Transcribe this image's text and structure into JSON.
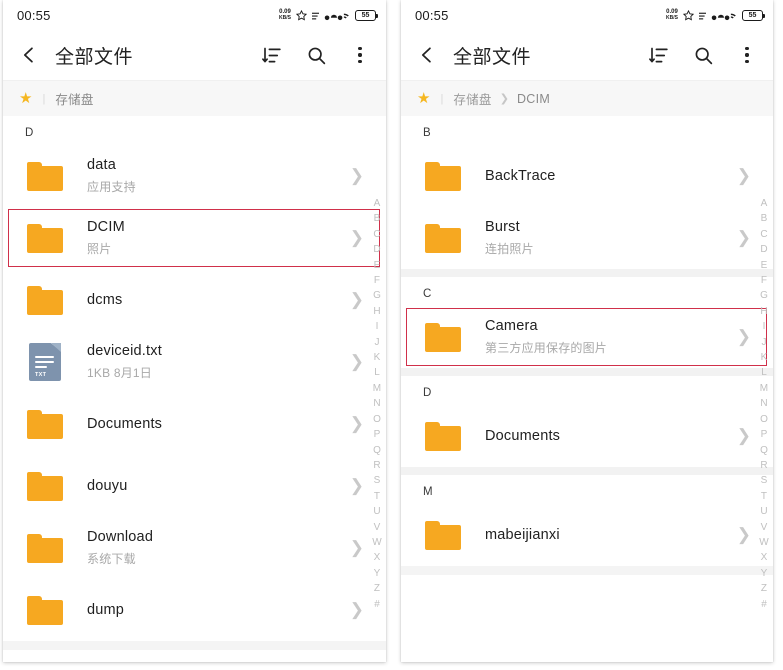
{
  "status_bar": {
    "clock": "00:55",
    "net_speed_value": "0.09",
    "net_speed_unit": "KB/S",
    "battery_percent": "55"
  },
  "app_bar": {
    "title": "全部文件",
    "back_icon": "chevron-left-icon",
    "sort_icon": "sort-icon",
    "search_icon": "search-icon",
    "more_icon": "more-vertical-icon"
  },
  "colors": {
    "folder": "#F6A821",
    "highlight": "#D0304A",
    "star": "#F5B721",
    "text": "#1F1F1F",
    "subtext": "#A8A8A8"
  },
  "alphabet_index": [
    "A",
    "B",
    "C",
    "D",
    "E",
    "F",
    "G",
    "H",
    "I",
    "J",
    "K",
    "L",
    "M",
    "N",
    "O",
    "P",
    "Q",
    "R",
    "S",
    "T",
    "U",
    "V",
    "W",
    "X",
    "Y",
    "Z",
    "#"
  ],
  "left_panel": {
    "breadcrumb": {
      "star_icon": "star-icon",
      "items": [
        {
          "label": "存储盘",
          "active": true
        }
      ]
    },
    "sections": [
      {
        "letter": "D",
        "items": [
          {
            "name": "data",
            "sub": "应用支持",
            "type": "folder",
            "highlighted": false
          },
          {
            "name": "DCIM",
            "sub": "照片",
            "type": "folder",
            "highlighted": true
          },
          {
            "name": "dcms",
            "sub": "",
            "type": "folder",
            "highlighted": false
          },
          {
            "name": "deviceid.txt",
            "sub": "1KB  8月1日",
            "type": "txt",
            "highlighted": false
          },
          {
            "name": "Documents",
            "sub": "",
            "type": "folder",
            "highlighted": false
          },
          {
            "name": "douyu",
            "sub": "",
            "type": "folder",
            "highlighted": false
          },
          {
            "name": "Download",
            "sub": "系统下载",
            "type": "folder",
            "highlighted": false
          },
          {
            "name": "dump",
            "sub": "",
            "type": "folder",
            "highlighted": false
          }
        ]
      }
    ]
  },
  "right_panel": {
    "breadcrumb": {
      "star_icon": "star-icon",
      "items": [
        {
          "label": "存储盘",
          "active": false
        },
        {
          "label": "DCIM",
          "active": true
        }
      ]
    },
    "sections": [
      {
        "letter": "B",
        "items": [
          {
            "name": "BackTrace",
            "sub": "",
            "type": "folder",
            "highlighted": false
          },
          {
            "name": "Burst",
            "sub": "连拍照片",
            "type": "folder",
            "highlighted": false
          }
        ]
      },
      {
        "letter": "C",
        "items": [
          {
            "name": "Camera",
            "sub": "第三方应用保存的图片",
            "type": "folder",
            "highlighted": true
          }
        ]
      },
      {
        "letter": "D",
        "items": [
          {
            "name": "Documents",
            "sub": "",
            "type": "folder",
            "highlighted": false
          }
        ]
      },
      {
        "letter": "M",
        "items": [
          {
            "name": "mabeijianxi",
            "sub": "",
            "type": "folder",
            "highlighted": false
          }
        ]
      }
    ]
  }
}
